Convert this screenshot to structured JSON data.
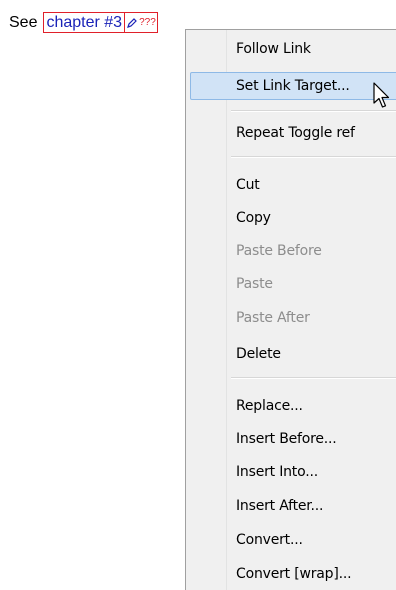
{
  "document": {
    "prefix": "See",
    "link_text": "chapter #3",
    "link_target": "???"
  },
  "context_menu": {
    "items": [
      {
        "label": "Follow Link",
        "disabled": false,
        "selected": false
      },
      {
        "label": "Set Link Target...",
        "disabled": false,
        "selected": true
      },
      {
        "label": "Repeat Toggle ref",
        "disabled": false,
        "selected": false
      },
      {
        "label": "Cut",
        "disabled": false,
        "selected": false
      },
      {
        "label": "Copy",
        "disabled": false,
        "selected": false
      },
      {
        "label": "Paste Before",
        "disabled": true,
        "selected": false
      },
      {
        "label": "Paste",
        "disabled": true,
        "selected": false
      },
      {
        "label": "Paste After",
        "disabled": true,
        "selected": false
      },
      {
        "label": "Delete",
        "disabled": false,
        "selected": false
      },
      {
        "label": "Replace...",
        "disabled": false,
        "selected": false
      },
      {
        "label": "Insert Before...",
        "disabled": false,
        "selected": false
      },
      {
        "label": "Insert Into...",
        "disabled": false,
        "selected": false
      },
      {
        "label": "Insert After...",
        "disabled": false,
        "selected": false
      },
      {
        "label": "Convert...",
        "disabled": false,
        "selected": false
      },
      {
        "label": "Convert [wrap]...",
        "disabled": false,
        "selected": false
      }
    ]
  },
  "colors": {
    "link_text": "#1a23b8",
    "link_border": "#e0202a",
    "menu_bg": "#f0f0f0",
    "selected_bg": "#d1e3f6",
    "selected_border": "#8eb9e6",
    "disabled_text": "#8d8d8d"
  },
  "icons": {
    "link_target": "pen-icon",
    "pointer": "mouse-cursor-icon"
  }
}
